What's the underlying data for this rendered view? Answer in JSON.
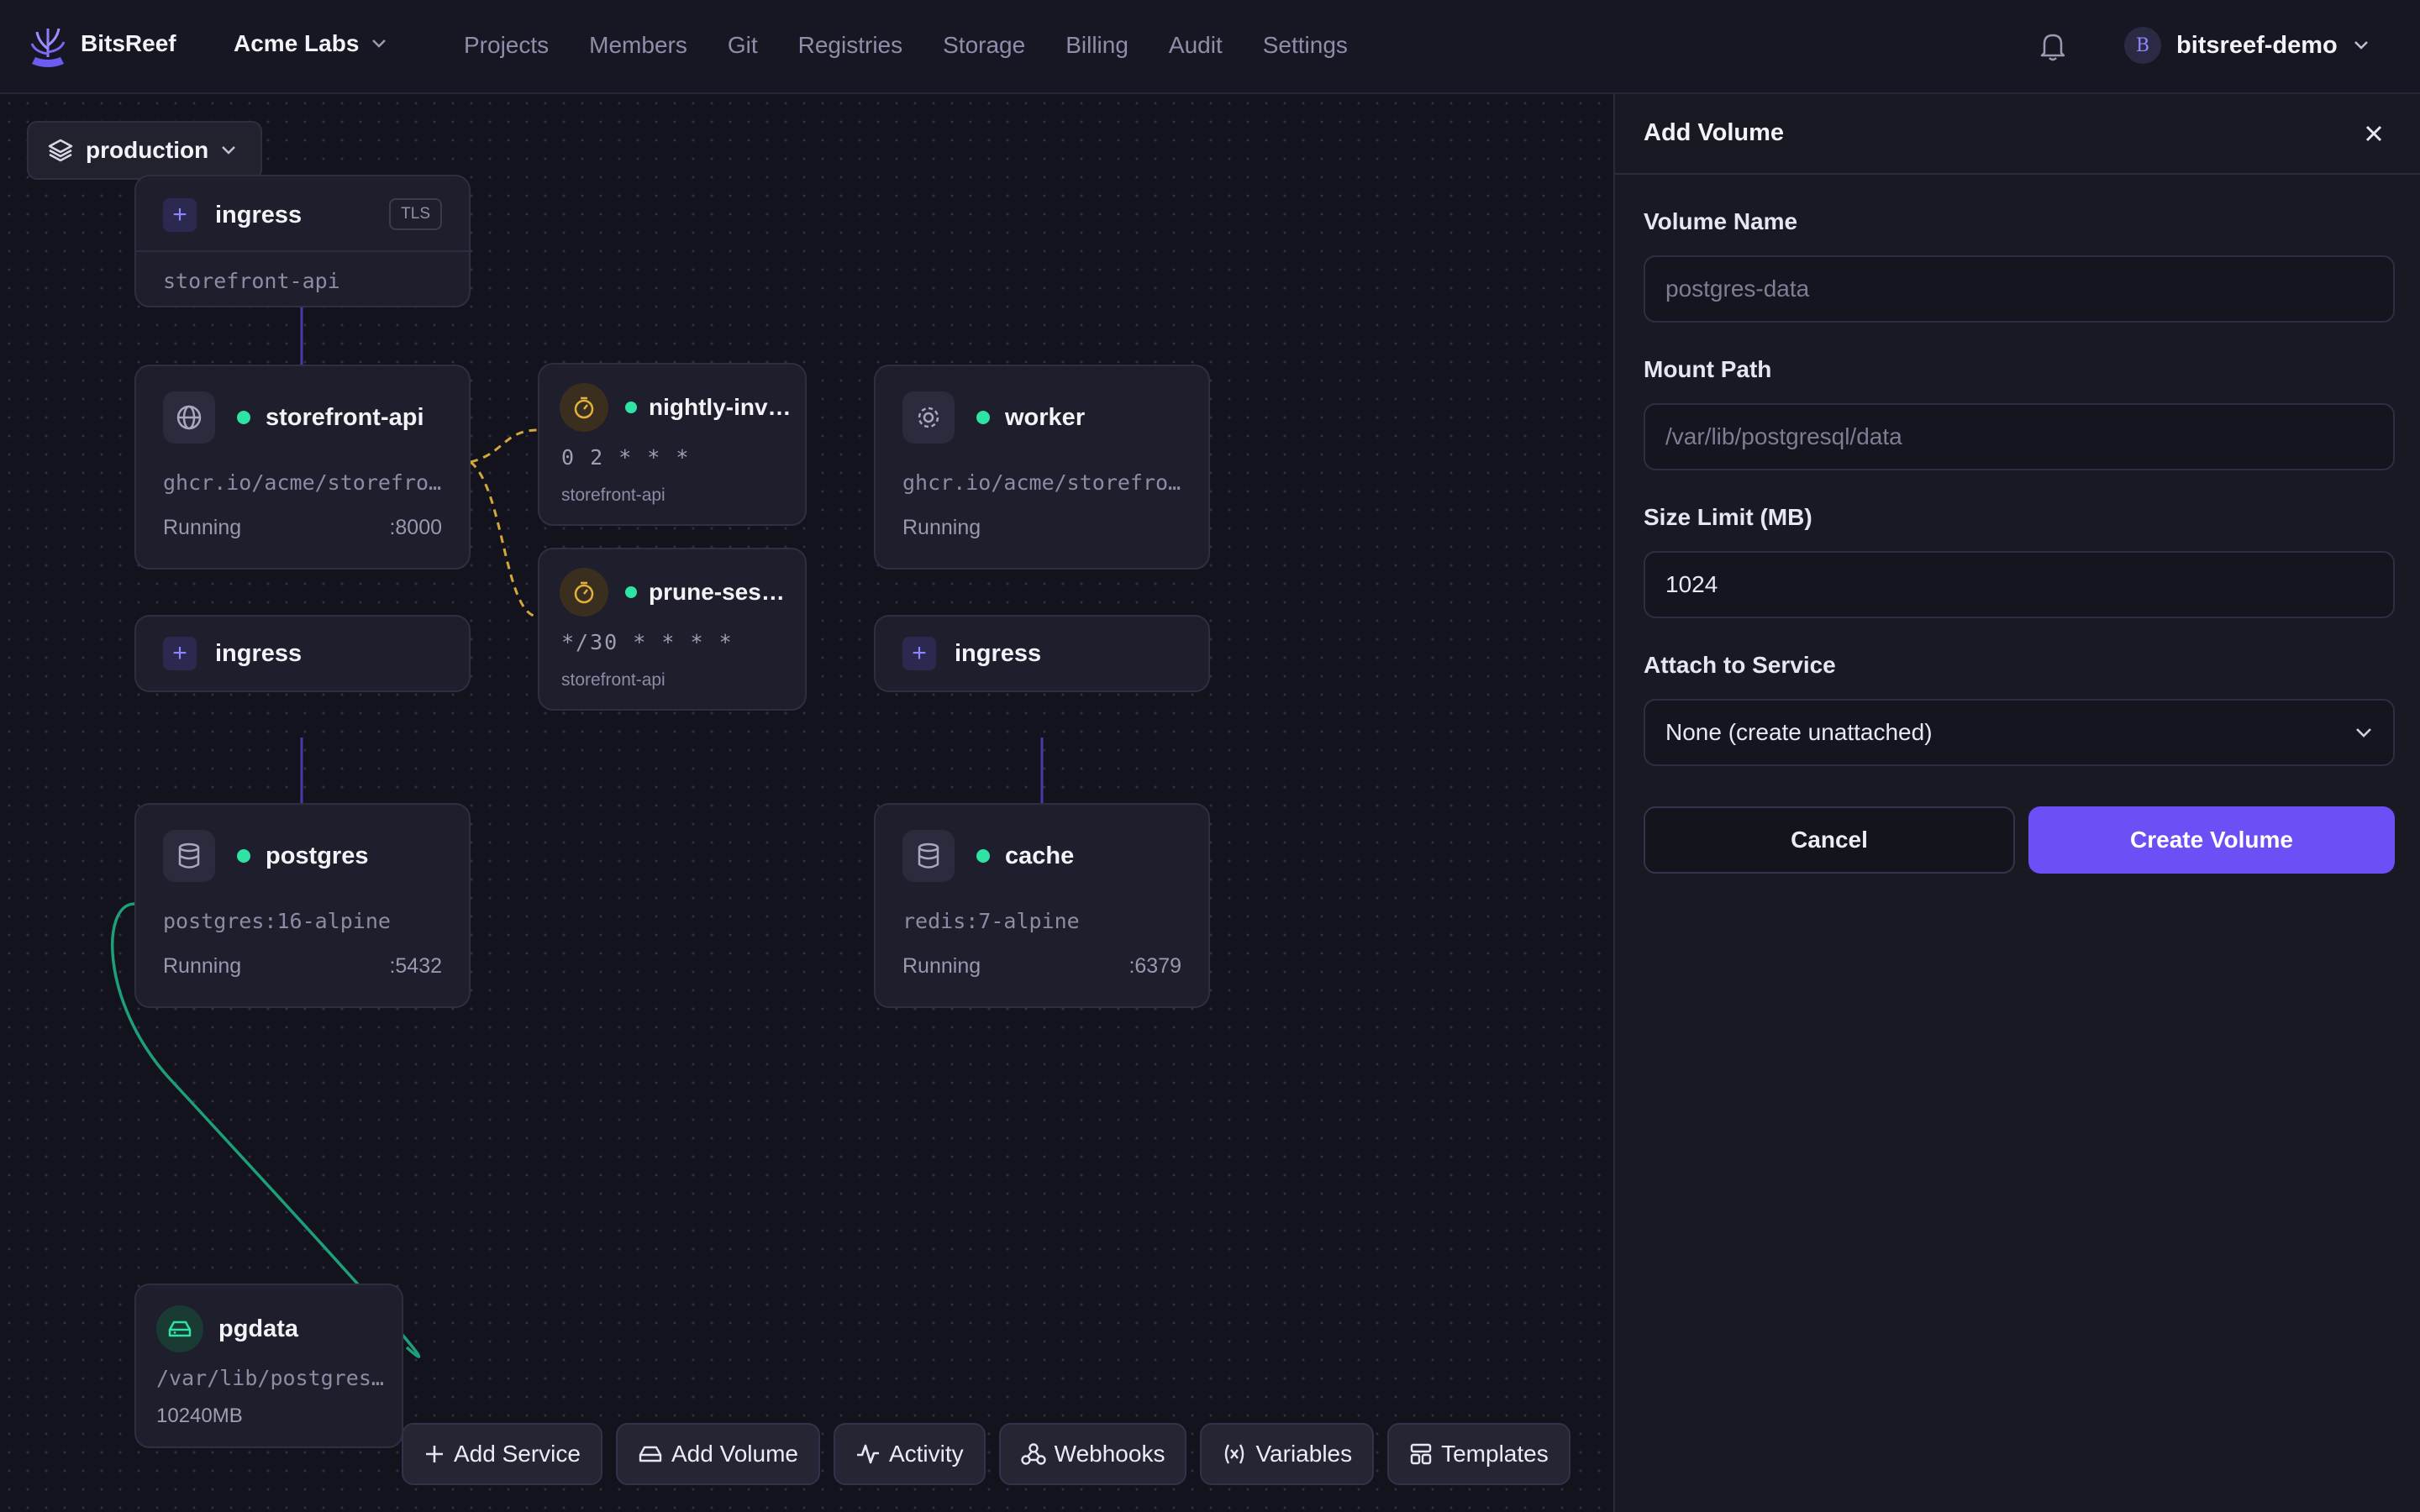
{
  "topbar": {
    "brand": "BitsReef",
    "org": "Acme Labs",
    "nav": [
      "Projects",
      "Members",
      "Git",
      "Registries",
      "Storage",
      "Billing",
      "Audit",
      "Settings"
    ],
    "user": {
      "initial": "B",
      "name": "bitsreef-demo"
    }
  },
  "canvas": {
    "environment": "production",
    "ingress_top": {
      "label": "ingress",
      "badge": "TLS",
      "target": "storefront-api"
    },
    "services": {
      "storefront": {
        "name": "storefront-api",
        "image": "ghcr.io/acme/storefro…",
        "status": "Running",
        "port": ":8000"
      },
      "worker": {
        "name": "worker",
        "image": "ghcr.io/acme/storefro…",
        "status": "Running"
      },
      "postgres": {
        "name": "postgres",
        "image": "postgres:16-alpine",
        "status": "Running",
        "port": ":5432"
      },
      "cache": {
        "name": "cache",
        "image": "redis:7-alpine",
        "status": "Running",
        "port": ":6379"
      }
    },
    "crons": {
      "nightly": {
        "name": "nightly-inv…",
        "schedule": "0 2 * * *",
        "service": "storefront-api"
      },
      "prune": {
        "name": "prune-ses…",
        "schedule": "*/30 * * * *",
        "service": "storefront-api"
      }
    },
    "ingress_left": {
      "label": "ingress"
    },
    "ingress_right": {
      "label": "ingress"
    },
    "volume": {
      "name": "pgdata",
      "path": "/var/lib/postgres…",
      "size": "10240MB"
    }
  },
  "toolbar": {
    "add_service": "Add Service",
    "add_volume": "Add Volume",
    "activity": "Activity",
    "webhooks": "Webhooks",
    "variables": "Variables",
    "templates": "Templates"
  },
  "panel": {
    "title": "Add Volume",
    "name_label": "Volume Name",
    "name_placeholder": "postgres-data",
    "mount_label": "Mount Path",
    "mount_placeholder": "/var/lib/postgresql/data",
    "size_label": "Size Limit (MB)",
    "size_value": "1024",
    "attach_label": "Attach to Service",
    "attach_value": "None (create unattached)",
    "cancel": "Cancel",
    "create": "Create Volume"
  },
  "colors": {
    "accent": "#6e4ef5",
    "status_running": "#2ee3a3",
    "cron": "#e2b03c",
    "volume_link": "#1f9e7a",
    "ingress_link": "#4a3aa8"
  }
}
